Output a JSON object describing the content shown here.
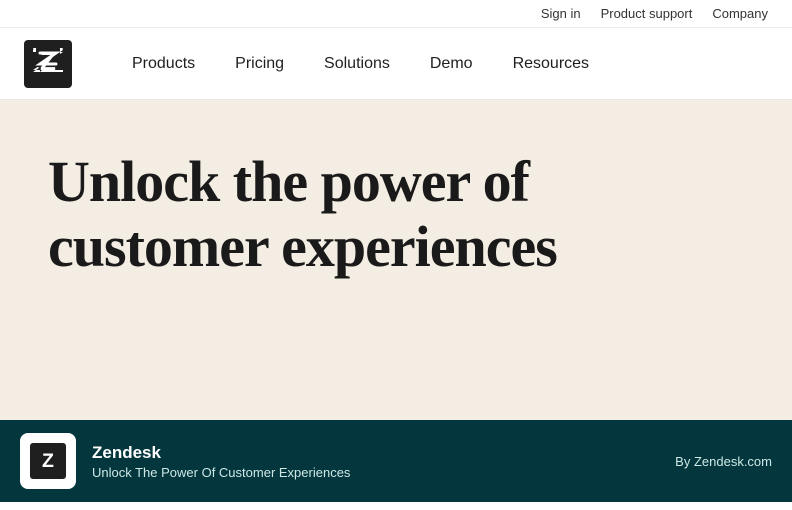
{
  "utility": {
    "links": [
      {
        "label": "Sign in",
        "name": "sign-in-link"
      },
      {
        "label": "Product support",
        "name": "product-support-link"
      },
      {
        "label": "Company",
        "name": "company-link"
      }
    ]
  },
  "nav": {
    "logo_alt": "Zendesk",
    "links": [
      {
        "label": "Products",
        "name": "nav-products"
      },
      {
        "label": "Pricing",
        "name": "nav-pricing"
      },
      {
        "label": "Solutions",
        "name": "nav-solutions"
      },
      {
        "label": "Demo",
        "name": "nav-demo"
      },
      {
        "label": "Resources",
        "name": "nav-resources"
      }
    ]
  },
  "hero": {
    "title": "Unlock the power of customer experiences"
  },
  "footer": {
    "brand": "Zendesk",
    "tagline": "Unlock The Power Of Customer Experiences",
    "url": "By Zendesk.com"
  }
}
